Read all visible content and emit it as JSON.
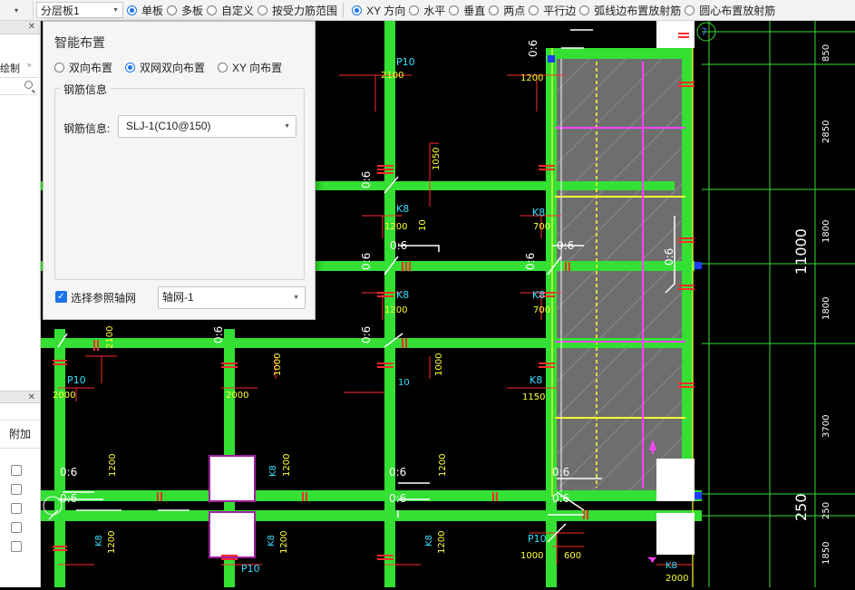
{
  "toolbar": {
    "layer_select": "分层板1",
    "group1": [
      {
        "label": "单板",
        "selected": true
      },
      {
        "label": "多板",
        "selected": false
      },
      {
        "label": "自定义",
        "selected": false
      },
      {
        "label": "按受力筋范围",
        "selected": false
      }
    ],
    "group2": [
      {
        "label": "XY 方向",
        "selected": true
      },
      {
        "label": "水平",
        "selected": false
      },
      {
        "label": "垂直",
        "selected": false
      },
      {
        "label": "两点",
        "selected": false
      },
      {
        "label": "平行边",
        "selected": false
      },
      {
        "label": "弧线边布置放射筋",
        "selected": false
      },
      {
        "label": "圆心布置放射筋",
        "selected": false
      }
    ]
  },
  "left_panel": {
    "close_top": "✕",
    "label": "绘制",
    "close_bottom": "✕",
    "column_header": "附加",
    "checkbox_count": 5
  },
  "dialog": {
    "title": "智能布置",
    "modes": [
      {
        "label": "双向布置",
        "selected": false
      },
      {
        "label": "双网双向布置",
        "selected": true
      },
      {
        "label": "XY 向布置",
        "selected": false
      }
    ],
    "group_title": "钢筋信息",
    "rebar_label": "钢筋信息:",
    "rebar_value": "SLJ-1(C10@150)",
    "axis_checkbox_label": "选择参照轴网",
    "axis_checked": true,
    "axis_value": "轴网-1"
  },
  "drawing": {
    "dim_total": "11000",
    "dim_250": "250",
    "dim_segments": [
      "850",
      "2850",
      "1800",
      "1800",
      "3700",
      "250",
      "1850"
    ],
    "axis_number": "7",
    "rebar_labels": {
      "p10": "P10",
      "k8": "K8",
      "slope": "0:6",
      "v2100": "2100",
      "v1200": "1200",
      "v1050": "1050",
      "v1000": "1000",
      "v700": "700",
      "v1150": "1150",
      "v600": "600",
      "v2000": "2000",
      "v10": "10"
    }
  },
  "colors": {
    "beam": "#33e033",
    "slab_fill": "#6e6e6e",
    "dim_white": "#ffffff",
    "rebar_red": "#ff2b2b",
    "rebar_yellow": "#ffff33",
    "rebar_magenta": "#ff44ff",
    "accent": "#1a73e8"
  }
}
